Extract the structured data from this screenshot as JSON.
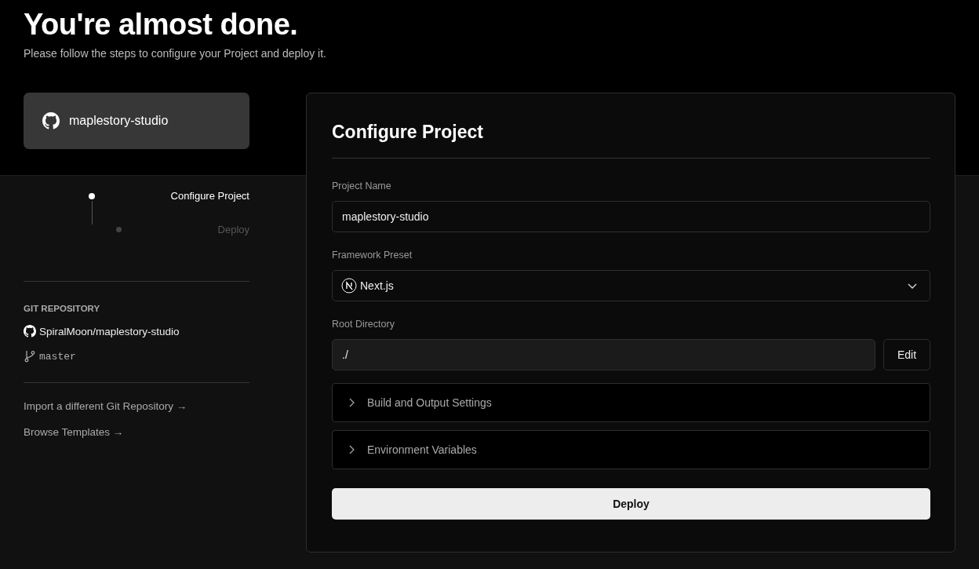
{
  "header": {
    "title": "You're almost done.",
    "subtitle": "Please follow the steps to configure your Project and deploy it."
  },
  "repo_card": {
    "name": "maplestory-studio"
  },
  "steps": [
    {
      "label": "Configure Project",
      "selected": true
    },
    {
      "label": "Deploy",
      "selected": false
    }
  ],
  "git": {
    "heading": "GIT REPOSITORY",
    "repository": "SpiralMoon/maplestory-studio",
    "branch": "master"
  },
  "links": [
    "Import a different Git Repository →",
    "Browse Templates →"
  ],
  "configure": {
    "title": "Configure Project",
    "project_name": {
      "label": "Project Name",
      "value": "maplestory-studio"
    },
    "framework": {
      "label": "Framework Preset",
      "value": "Next.js"
    },
    "root_directory": {
      "label": "Root Directory",
      "value": "./",
      "button": "Edit"
    },
    "sections": [
      {
        "label": "Build and Output Settings",
        "expanded": false
      },
      {
        "label": "Environment Variables",
        "expanded": false
      }
    ],
    "deploy_button": "Deploy"
  }
}
